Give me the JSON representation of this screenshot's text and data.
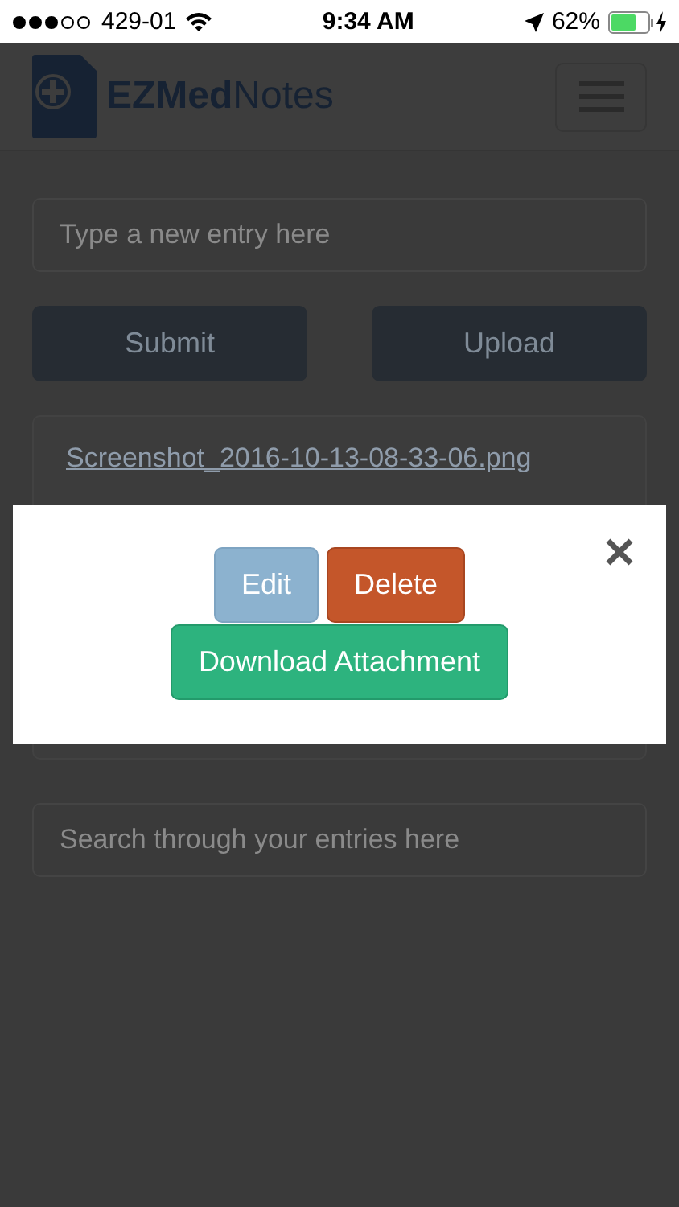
{
  "status_bar": {
    "carrier": "429-01",
    "time": "9:34 AM",
    "battery": "62%"
  },
  "navbar": {
    "brand": "**EZMed**Notes"
  },
  "entry_field": {
    "placeholder": "Type a new entry here"
  },
  "buttons": [
    {
      "label": "Submit"
    },
    {
      "label": "Upload"
    }
  ],
  "entries": [
    {
      "file": "Screenshot_2016-10-13-08-33-06.png"
    }
  ],
  "search": {
    "placeholder": "Search through your entries here"
  },
  "modal": {
    "actions": [
      {
        "label": "Edit",
        "kind": "edit"
      },
      {
        "label": "Delete",
        "kind": "delete"
      },
      {
        "label": "Download Attachment",
        "kind": "download"
      }
    ]
  }
}
